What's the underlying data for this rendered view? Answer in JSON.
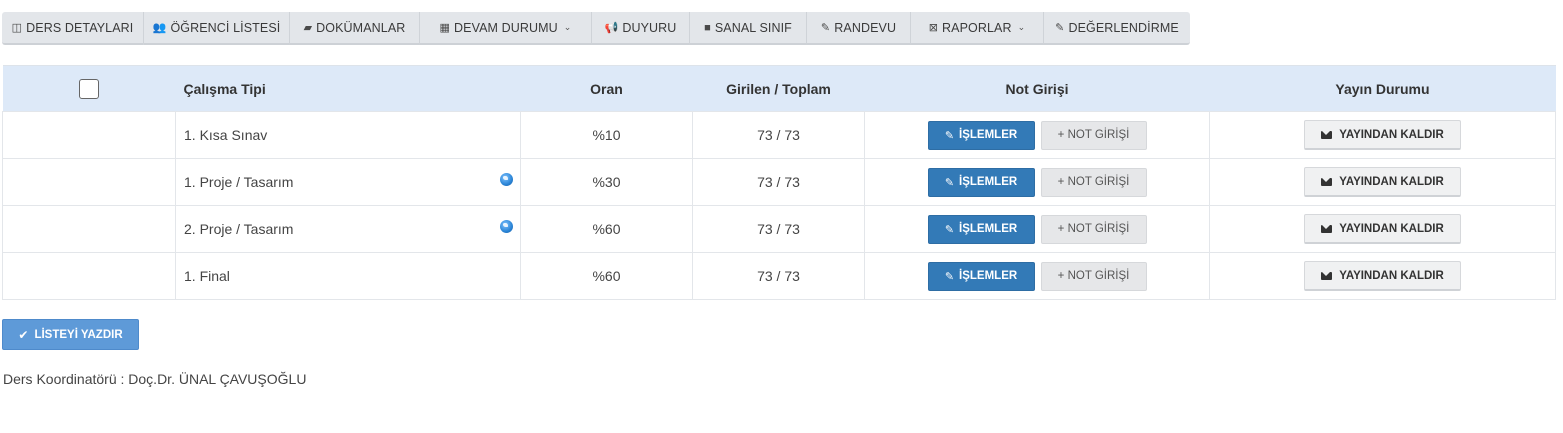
{
  "toolbar": {
    "items": [
      {
        "label": "DERS DETAYLARI",
        "icon": "columns-icon"
      },
      {
        "label": "ÖĞRENCİ LİSTESİ",
        "icon": "users-icon"
      },
      {
        "label": "DOKÜMANLAR",
        "icon": "book-icon"
      },
      {
        "label": "DEVAM DURUMU",
        "icon": "calendar-icon",
        "dropdown": true
      },
      {
        "label": "DUYURU",
        "icon": "bullhorn-icon"
      },
      {
        "label": "SANAL SINIF",
        "icon": "video-icon"
      },
      {
        "label": "RANDEVU",
        "icon": "edit-icon"
      },
      {
        "label": "RAPORLAR",
        "icon": "excel-file-icon",
        "dropdown": true
      },
      {
        "label": "DEĞERLENDİRME",
        "icon": "pencil-icon"
      }
    ]
  },
  "table": {
    "headers": {
      "type": "Çalışma Tipi",
      "rate": "Oran",
      "entered": "Girilen / Toplam",
      "grade_entry": "Not Girişi",
      "publish": "Yayın Durumu"
    },
    "rows": [
      {
        "type": "1. Kısa Sınav",
        "rate": "%10",
        "entered": "73 / 73",
        "globe": false
      },
      {
        "type": "1. Proje / Tasarım",
        "rate": "%30",
        "entered": "73 / 73",
        "globe": true
      },
      {
        "type": "2. Proje / Tasarım",
        "rate": "%60",
        "entered": "73 / 73",
        "globe": true
      },
      {
        "type": "1. Final",
        "rate": "%60",
        "entered": "73 / 73",
        "globe": false
      }
    ],
    "actions": {
      "operations_label": "İŞLEMLER",
      "grade_entry_label": "+ NOT GİRİŞİ",
      "unpublish_label": "YAYINDAN KALDIR"
    }
  },
  "print_button": {
    "label": "LİSTEYİ YAZDIR"
  },
  "coordinator": {
    "text": "Ders Koordinatörü : Doç.Dr. ÜNAL ÇAVUŞOĞLU"
  },
  "colors": {
    "primary": "#337ab7",
    "header_bg": "#dde9f8",
    "print_bg": "#5e9ad8"
  }
}
